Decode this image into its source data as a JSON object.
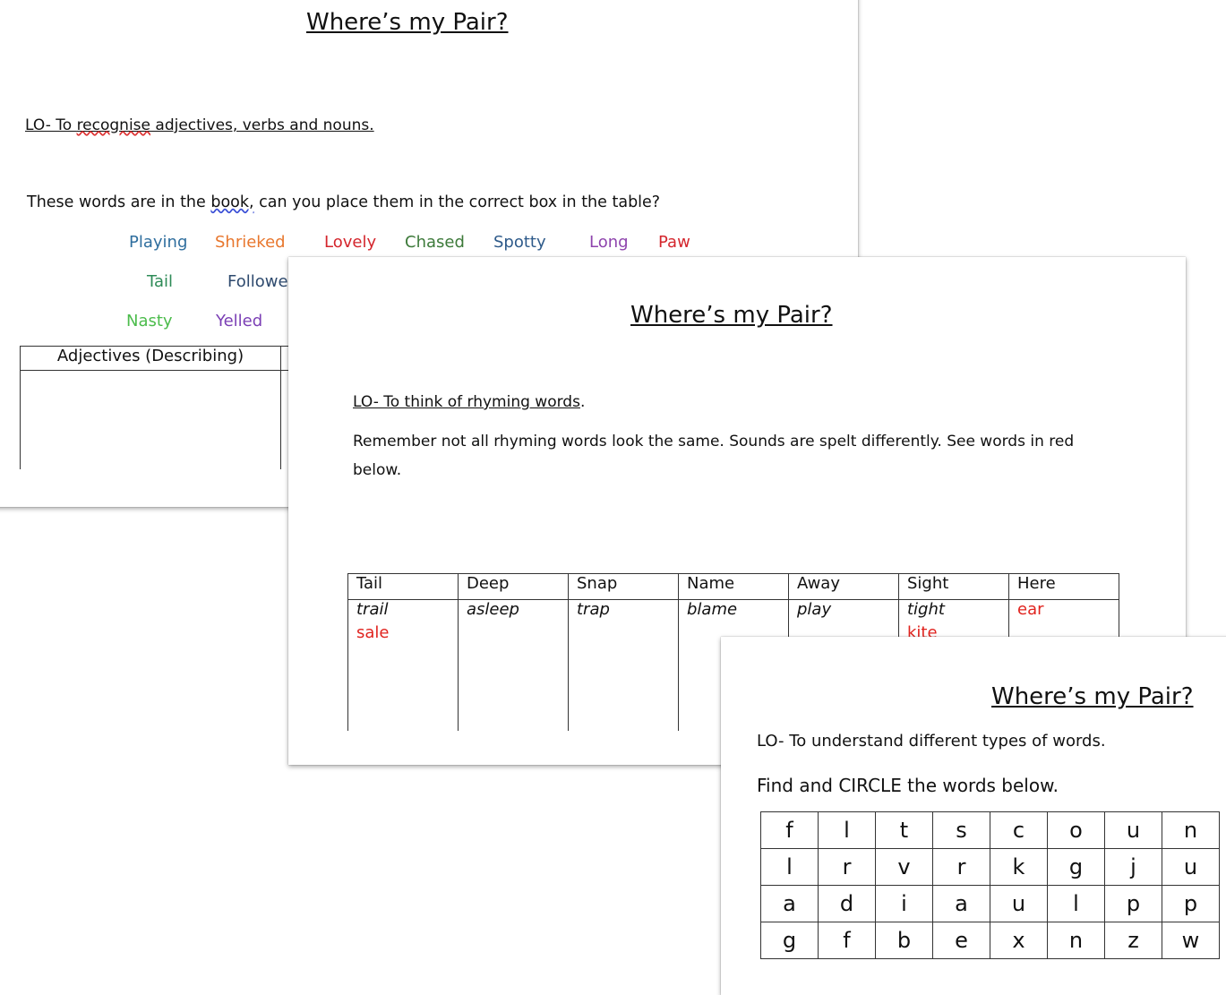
{
  "sheet1": {
    "title": "Where’s my Pair?",
    "lo_prefix": "LO- To ",
    "lo_squiggle": "recognise",
    "lo_suffix": " adjectives, verbs and nouns.",
    "instruction_a": "These words are in the ",
    "instruction_b": "book,",
    "instruction_c": " can you place them in the correct box in the table?",
    "words": [
      {
        "text": "Playing",
        "color": "#2f6e9e"
      },
      {
        "text": "Shrieked",
        "color": "#e8772e"
      },
      {
        "text": "Lovely",
        "color": "#d4262d"
      },
      {
        "text": "Chased",
        "color": "#3d7a3a"
      },
      {
        "text": "Spotty",
        "color": "#2e5a8a"
      },
      {
        "text": "Long",
        "color": "#8e44ad"
      },
      {
        "text": "Paw",
        "color": "#d4262d"
      },
      {
        "text": "Tail",
        "color": "#2e8b57"
      },
      {
        "text": "Followe",
        "color": "#2e4a6e"
      },
      {
        "text": "Nasty",
        "color": "#4cbc4c"
      },
      {
        "text": "Yelled",
        "color": "#7b3fb5"
      }
    ],
    "table_header": "Adjectives (Describing)"
  },
  "sheet2": {
    "title": "Where’s my Pair?",
    "lo": "LO- To think of rhyming words",
    "lo_end": ".",
    "remember_line1": "Remember not all rhyming words look the same. Sounds are spelt differently. See words in red",
    "remember_line2": "below.",
    "columns": [
      {
        "header": "Tail",
        "black": "trail",
        "red": "sale"
      },
      {
        "header": "Deep",
        "black": "asleep",
        "red": ""
      },
      {
        "header": "Snap",
        "black": "trap",
        "red": ""
      },
      {
        "header": "Name",
        "black": "blame",
        "red": ""
      },
      {
        "header": "Away",
        "black": "play",
        "red": ""
      },
      {
        "header": "Sight",
        "black": "tight",
        "red": "kite"
      },
      {
        "header": "Here",
        "black": "",
        "red": "ear"
      }
    ]
  },
  "sheet3": {
    "title": "Where’s my Pair?",
    "lo": "LO- To understand different types of words.",
    "instruction": "Find and CIRCLE the words below.",
    "grid": [
      [
        "f",
        "l",
        "t",
        "s",
        "c",
        "o",
        "u",
        "n"
      ],
      [
        "l",
        "r",
        "v",
        "r",
        "k",
        "g",
        "j",
        "u"
      ],
      [
        "a",
        "d",
        "i",
        "a",
        "u",
        "l",
        "p",
        "p"
      ],
      [
        "g",
        "f",
        "b",
        "e",
        "x",
        "n",
        "z",
        "w"
      ]
    ]
  },
  "colors": {
    "red": "#e0231e",
    "page": "#ffffff"
  }
}
